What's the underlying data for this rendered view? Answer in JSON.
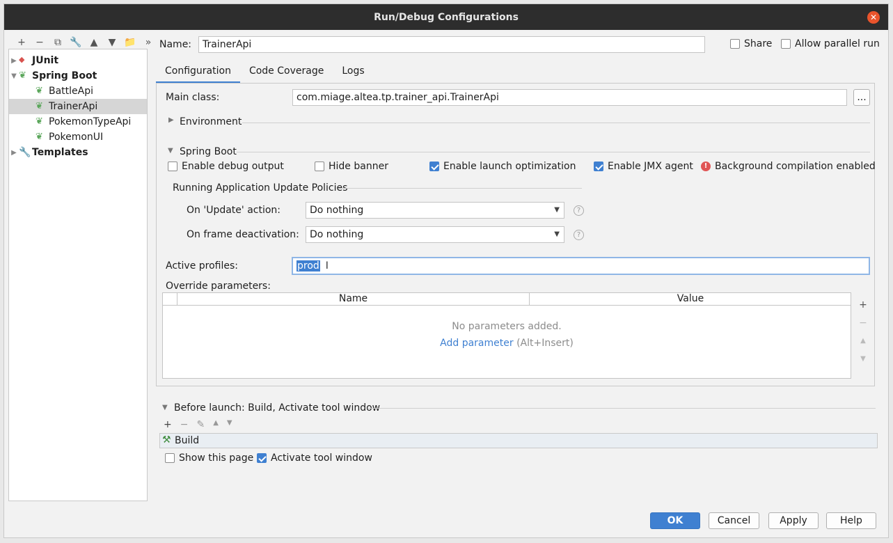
{
  "window": {
    "title": "Run/Debug Configurations"
  },
  "tree": {
    "junit": "JUnit",
    "spring_boot": "Spring Boot",
    "items": [
      "BattleApi",
      "TrainerApi",
      "PokemonTypeApi",
      "PokemonUI"
    ],
    "templates": "Templates",
    "selected": "TrainerApi"
  },
  "header": {
    "name_label": "Name:",
    "name_value": "TrainerApi",
    "share_label": "Share",
    "parallel_label": "Allow parallel run"
  },
  "tabs": [
    "Configuration",
    "Code Coverage",
    "Logs"
  ],
  "config": {
    "main_class_label": "Main class:",
    "main_class_value": "com.miage.altea.tp.trainer_api.TrainerApi",
    "browse_label": "...",
    "environment_label": "Environment",
    "spring_boot_label": "Spring Boot",
    "enable_debug_label": "Enable debug output",
    "hide_banner_label": "Hide banner",
    "launch_opt_label": "Enable launch optimization",
    "jmx_label": "Enable JMX agent",
    "bg_compile_label": "Background compilation enabled",
    "policies_label": "Running Application Update Policies",
    "update_action_label": "On 'Update' action:",
    "update_action_value": "Do nothing",
    "frame_deact_label": "On frame deactivation:",
    "frame_deact_value": "Do nothing",
    "active_profiles_label": "Active profiles:",
    "active_profiles_value": "prod",
    "override_label": "Override parameters:",
    "col_name": "Name",
    "col_value": "Value",
    "no_params": "No parameters added.",
    "add_param": "Add parameter",
    "add_param_hint": "(Alt+Insert)"
  },
  "before_launch": {
    "header": "Before launch: Build, Activate tool window",
    "build_item": "Build",
    "show_page_label": "Show this page",
    "activate_label": "Activate tool window"
  },
  "footer": {
    "ok": "OK",
    "cancel": "Cancel",
    "apply": "Apply",
    "help": "Help"
  },
  "colors": {
    "accent": "#3f80d1",
    "error": "#e05555"
  }
}
